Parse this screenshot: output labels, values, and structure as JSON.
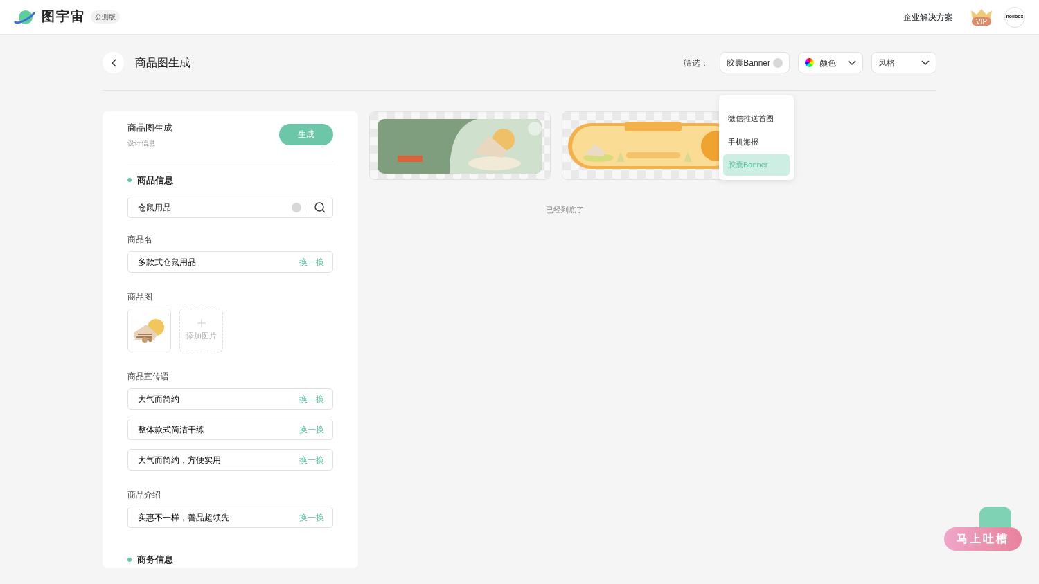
{
  "header": {
    "logo_text": "图宇宙",
    "badge": "公测版",
    "enterprise_link": "企业解决方案",
    "vip_label": "VIP",
    "avatar_text": "nolibox"
  },
  "toolbar": {
    "title": "商品图生成",
    "filter_label": "筛选：",
    "filters": [
      {
        "kind": "tag",
        "label": "胶囊Banner"
      },
      {
        "kind": "color",
        "label": "颜色"
      },
      {
        "kind": "select",
        "label": "风格"
      }
    ],
    "dropdown": [
      {
        "label": "微信推送首图",
        "selected": false
      },
      {
        "label": "手机海报",
        "selected": false
      },
      {
        "label": "胶囊Banner",
        "selected": true
      }
    ]
  },
  "form": {
    "title": "商品图生成",
    "subtitle": "设计信息",
    "generate_button": "生成",
    "section_1": "商品信息",
    "search_value": "仓鼠用品",
    "name_label": "商品名",
    "name_value": "多款式仓鼠用品",
    "swap": "换一换",
    "image_label": "商品图",
    "add_image": "添加图片",
    "slogan_label": "商品宣传语",
    "slogans": [
      {
        "value": "大气而简约",
        "swap": "换一换"
      },
      {
        "value": "整体款式简洁干练",
        "swap": "换一换"
      },
      {
        "value": "大气而简约，方便实用",
        "swap": "换一换"
      }
    ],
    "intro_label": "商品介绍",
    "intro_value": "实惠不一样，善品超领先",
    "intro_swap": "换一换",
    "section_2": "商务信息"
  },
  "results": {
    "end_text": "已经到底了"
  },
  "feedback_button": "马上吐槽"
}
